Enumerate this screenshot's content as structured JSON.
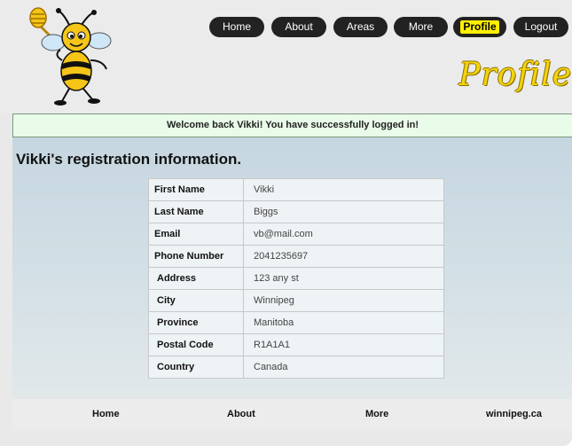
{
  "nav": {
    "items": [
      {
        "label": "Home"
      },
      {
        "label": "About"
      },
      {
        "label": "Areas"
      },
      {
        "label": "More"
      },
      {
        "label": "Profile",
        "active": true
      },
      {
        "label": "Logout"
      }
    ]
  },
  "header": {
    "page_title": "Profile"
  },
  "welcome": {
    "message": "Welcome back Vikki! You have successfully logged in!"
  },
  "registration": {
    "title": "Vikki's registration information.",
    "rows": [
      {
        "label": "First Name",
        "value": "Vikki"
      },
      {
        "label": "Last Name",
        "value": "Biggs"
      },
      {
        "label": "Email",
        "value": "vb@mail.com"
      },
      {
        "label": "Phone Number",
        "value": "2041235697"
      },
      {
        "label": "Address",
        "value": "123 any st"
      },
      {
        "label": "City",
        "value": "Winnipeg"
      },
      {
        "label": "Province",
        "value": "Manitoba"
      },
      {
        "label": "Postal Code",
        "value": "R1A1A1"
      },
      {
        "label": "Country",
        "value": "Canada"
      }
    ]
  },
  "footer": {
    "links": [
      {
        "label": "Home"
      },
      {
        "label": "About"
      },
      {
        "label": "More"
      },
      {
        "label": "winnipeg.ca"
      }
    ]
  },
  "colors": {
    "nav_bg": "#222222",
    "active_highlight": "#ffef00",
    "heading_yellow": "#f4d30a",
    "welcome_bg": "#e9fbe9"
  }
}
